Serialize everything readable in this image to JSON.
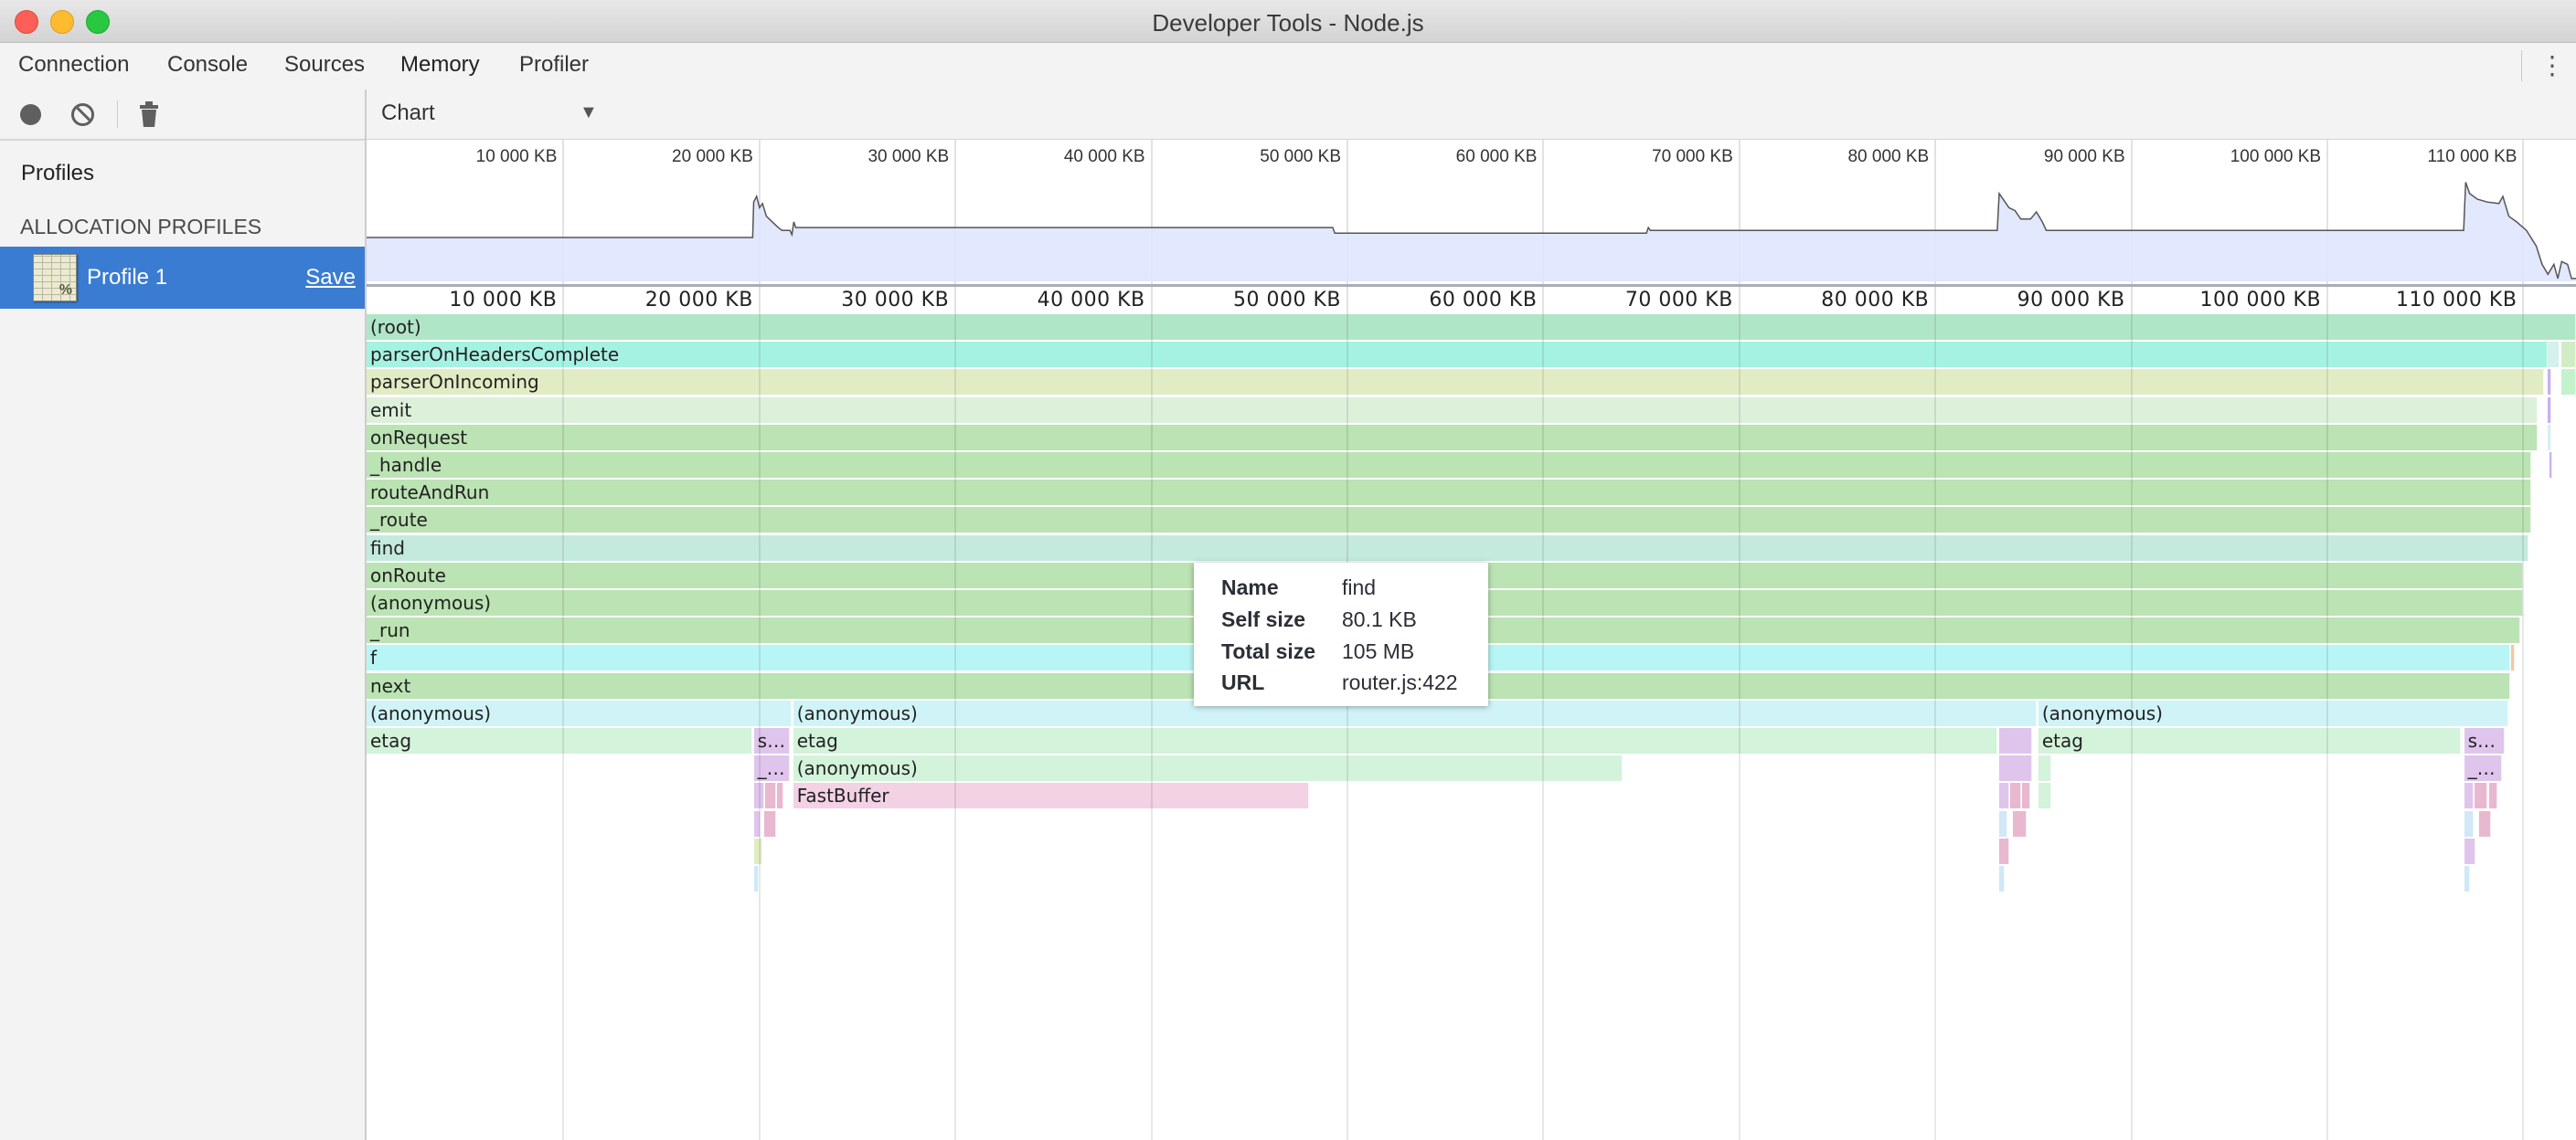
{
  "window": {
    "title": "Developer Tools - Node.js"
  },
  "tabs": [
    {
      "label": "Connection",
      "active": false
    },
    {
      "label": "Console",
      "active": false
    },
    {
      "label": "Sources",
      "active": false
    },
    {
      "label": "Memory",
      "active": true
    },
    {
      "label": "Profiler",
      "active": false
    }
  ],
  "toolbar": {
    "record_icon": "record-circle",
    "clear_icon": "no-entry",
    "delete_icon": "trash"
  },
  "sidebar": {
    "heading": "Profiles",
    "section": "ALLOCATION PROFILES",
    "profiles": [
      {
        "name": "Profile 1",
        "save_label": "Save",
        "selected": true,
        "icon_glyph": "%"
      }
    ]
  },
  "view": {
    "selected": "Chart"
  },
  "axis": {
    "unit": "KB",
    "max_kb": 112730,
    "ticks": [
      {
        "value": 10000,
        "label": "10 000 KB"
      },
      {
        "value": 20000,
        "label": "20 000 KB"
      },
      {
        "value": 30000,
        "label": "30 000 KB"
      },
      {
        "value": 40000,
        "label": "40 000 KB"
      },
      {
        "value": 50000,
        "label": "50 000 KB"
      },
      {
        "value": 60000,
        "label": "60 000 KB"
      },
      {
        "value": 70000,
        "label": "70 000 KB"
      },
      {
        "value": 80000,
        "label": "80 000 KB"
      },
      {
        "value": 90000,
        "label": "90 000 KB"
      },
      {
        "value": 100000,
        "label": "100 000 KB"
      },
      {
        "value": 110000,
        "label": "110 000 KB"
      }
    ]
  },
  "overview": {
    "fill": "#dfe5fd",
    "line": "#555555",
    "levels": [
      [
        0,
        0.31
      ],
      [
        19700,
        0.31
      ],
      [
        19750,
        0.56
      ],
      [
        19900,
        0.6
      ],
      [
        20050,
        0.52
      ],
      [
        20200,
        0.55
      ],
      [
        20400,
        0.46
      ],
      [
        20700,
        0.42
      ],
      [
        21000,
        0.38
      ],
      [
        21200,
        0.36
      ],
      [
        21600,
        0.36
      ],
      [
        21700,
        0.33
      ],
      [
        21800,
        0.42
      ],
      [
        21900,
        0.38
      ],
      [
        49300,
        0.38
      ],
      [
        49400,
        0.34
      ],
      [
        65300,
        0.34
      ],
      [
        65400,
        0.38
      ],
      [
        65500,
        0.36
      ],
      [
        83200,
        0.36
      ],
      [
        83300,
        0.62
      ],
      [
        83500,
        0.58
      ],
      [
        83800,
        0.52
      ],
      [
        84100,
        0.5
      ],
      [
        84400,
        0.44
      ],
      [
        84900,
        0.44
      ],
      [
        85200,
        0.49
      ],
      [
        85500,
        0.42
      ],
      [
        85700,
        0.36
      ],
      [
        107000,
        0.36
      ],
      [
        107100,
        0.7
      ],
      [
        107300,
        0.62
      ],
      [
        107700,
        0.58
      ],
      [
        108200,
        0.56
      ],
      [
        108800,
        0.55
      ],
      [
        109000,
        0.6
      ],
      [
        109300,
        0.46
      ],
      [
        109700,
        0.42
      ],
      [
        110200,
        0.36
      ],
      [
        110700,
        0.25
      ],
      [
        111000,
        0.12
      ],
      [
        111300,
        0.05
      ],
      [
        111600,
        0.12
      ],
      [
        111800,
        0.02
      ],
      [
        112000,
        0.14
      ],
      [
        112300,
        0.12
      ],
      [
        112500,
        0.02
      ],
      [
        112730,
        0.02
      ]
    ]
  },
  "flame": {
    "frames": [
      {
        "row": 0,
        "name": "(root)",
        "start": 0,
        "end": 112730,
        "color": "#b0e6c8"
      },
      {
        "row": 1,
        "name": "parserOnHeadersComplete",
        "start": 0,
        "end": 111290,
        "color": "#a6f2e2"
      },
      {
        "row": 1,
        "name": "",
        "start": 111300,
        "end": 111900,
        "color": "#d6f0ee"
      },
      {
        "row": 1,
        "name": "",
        "start": 112000,
        "end": 112730,
        "color": "#d2ecc8"
      },
      {
        "row": 2,
        "name": "parserOnIncoming",
        "start": 0,
        "end": 111120,
        "color": "#e2ecc4"
      },
      {
        "row": 2,
        "name": "",
        "start": 111300,
        "end": 111450,
        "color": "#c9b0ec"
      },
      {
        "row": 2,
        "name": "",
        "start": 112000,
        "end": 112730,
        "color": "#c3f3cc"
      },
      {
        "row": 3,
        "name": "emit",
        "start": 0,
        "end": 110790,
        "color": "#dcf0da"
      },
      {
        "row": 3,
        "name": "",
        "start": 111300,
        "end": 111450,
        "color": "#c9b0ec"
      },
      {
        "row": 4,
        "name": "onRequest",
        "start": 0,
        "end": 110790,
        "color": "#bbe3b3"
      },
      {
        "row": 4,
        "name": "",
        "start": 111300,
        "end": 111450,
        "color": "#d6f0ee"
      },
      {
        "row": 5,
        "name": "_handle",
        "start": 0,
        "end": 110450,
        "color": "#bbe3b3"
      },
      {
        "row": 5,
        "name": "",
        "start": 111400,
        "end": 111500,
        "color": "#c9b0ec"
      },
      {
        "row": 6,
        "name": "routeAndRun",
        "start": 0,
        "end": 110450,
        "color": "#bbe3b3"
      },
      {
        "row": 7,
        "name": "_route",
        "start": 0,
        "end": 110450,
        "color": "#bbe3b3"
      },
      {
        "row": 8,
        "name": "find",
        "start": 0,
        "end": 110290,
        "color": "#c4eade"
      },
      {
        "row": 9,
        "name": "onRoute",
        "start": 0,
        "end": 110040,
        "color": "#bbe3b3"
      },
      {
        "row": 10,
        "name": "(anonymous)",
        "start": 0,
        "end": 110040,
        "color": "#bbe3b3"
      },
      {
        "row": 11,
        "name": "_run",
        "start": 0,
        "end": 109870,
        "color": "#bbe3b3"
      },
      {
        "row": 12,
        "name": "f",
        "start": 0,
        "end": 109370,
        "color": "#b8f5f5"
      },
      {
        "row": 12,
        "name": "",
        "start": 109400,
        "end": 109600,
        "color": "#f3c8a0"
      },
      {
        "row": 13,
        "name": "next",
        "start": 0,
        "end": 109370,
        "color": "#bbe3b3"
      },
      {
        "row": 14,
        "name": "(anonymous)",
        "start": 0,
        "end": 21690,
        "color": "#d0f3f7"
      },
      {
        "row": 14,
        "name": "(anonymous)",
        "start": 21770,
        "end": 85220,
        "color": "#d0f3f7"
      },
      {
        "row": 14,
        "name": "(anonymous)",
        "start": 85300,
        "end": 109280,
        "color": "#d0f3f7"
      },
      {
        "row": 15,
        "name": "etag",
        "start": 0,
        "end": 19670,
        "color": "#d3f3da"
      },
      {
        "row": 15,
        "name": "s…",
        "start": 19760,
        "end": 21600,
        "color": "#dfc5ec"
      },
      {
        "row": 15,
        "name": "etag",
        "start": 21770,
        "end": 83210,
        "color": "#d3f3da"
      },
      {
        "row": 15,
        "name": "",
        "start": 83290,
        "end": 84970,
        "color": "#dfc5ec"
      },
      {
        "row": 15,
        "name": "etag",
        "start": 85300,
        "end": 106850,
        "color": "#d3f3da"
      },
      {
        "row": 15,
        "name": "s…",
        "start": 107020,
        "end": 109110,
        "color": "#dfc5ec"
      },
      {
        "row": 16,
        "name": "_…",
        "start": 19760,
        "end": 21600,
        "color": "#dfc5ec"
      },
      {
        "row": 16,
        "name": "(anonymous)",
        "start": 21770,
        "end": 64100,
        "color": "#d3f3da"
      },
      {
        "row": 16,
        "name": "",
        "start": 83290,
        "end": 84970,
        "color": "#dfc5ec"
      },
      {
        "row": 16,
        "name": "",
        "start": 85300,
        "end": 85950,
        "color": "#d3f3da"
      },
      {
        "row": 16,
        "name": "_…",
        "start": 107020,
        "end": 108940,
        "color": "#dfc5ec"
      },
      {
        "row": 17,
        "name": "",
        "start": 19760,
        "end": 20300,
        "color": "#dfc5ec"
      },
      {
        "row": 17,
        "name": "",
        "start": 20350,
        "end": 20900,
        "color": "#e8b8d0"
      },
      {
        "row": 17,
        "name": "",
        "start": 20950,
        "end": 21250,
        "color": "#e8b8d0"
      },
      {
        "row": 17,
        "name": "FastBuffer",
        "start": 21770,
        "end": 48090,
        "color": "#f2d2e4"
      },
      {
        "row": 17,
        "name": "",
        "start": 83290,
        "end": 83800,
        "color": "#dfc5ec"
      },
      {
        "row": 17,
        "name": "",
        "start": 83850,
        "end": 84400,
        "color": "#e8b8d0"
      },
      {
        "row": 17,
        "name": "",
        "start": 84450,
        "end": 84900,
        "color": "#e8b8d0"
      },
      {
        "row": 17,
        "name": "",
        "start": 85300,
        "end": 85950,
        "color": "#d3f3da"
      },
      {
        "row": 17,
        "name": "",
        "start": 107020,
        "end": 107500,
        "color": "#dfc5ec"
      },
      {
        "row": 17,
        "name": "",
        "start": 107550,
        "end": 108200,
        "color": "#e8b8d0"
      },
      {
        "row": 17,
        "name": "",
        "start": 108300,
        "end": 108700,
        "color": "#e8b8d0"
      },
      {
        "row": 18,
        "name": "",
        "start": 19760,
        "end": 20100,
        "color": "#dfc5ec"
      },
      {
        "row": 18,
        "name": "",
        "start": 20300,
        "end": 20900,
        "color": "#e8b8d0"
      },
      {
        "row": 18,
        "name": "",
        "start": 83290,
        "end": 83700,
        "color": "#d0e8f7"
      },
      {
        "row": 18,
        "name": "",
        "start": 84000,
        "end": 84700,
        "color": "#e8b8d0"
      },
      {
        "row": 18,
        "name": "",
        "start": 107020,
        "end": 107500,
        "color": "#d0e8f7"
      },
      {
        "row": 18,
        "name": "",
        "start": 107800,
        "end": 108400,
        "color": "#e8b8d0"
      },
      {
        "row": 19,
        "name": "",
        "start": 19760,
        "end": 20200,
        "color": "#e2ecc4"
      },
      {
        "row": 19,
        "name": "",
        "start": 83290,
        "end": 83800,
        "color": "#e8b8d0"
      },
      {
        "row": 19,
        "name": "",
        "start": 107020,
        "end": 107600,
        "color": "#dfc5ec"
      },
      {
        "row": 20,
        "name": "",
        "start": 19760,
        "end": 20000,
        "color": "#d0e8f7"
      },
      {
        "row": 20,
        "name": "",
        "start": 83290,
        "end": 83600,
        "color": "#d0e8f7"
      },
      {
        "row": 20,
        "name": "",
        "start": 107020,
        "end": 107300,
        "color": "#d0e8f7"
      }
    ]
  },
  "tooltip": {
    "rows": [
      {
        "key": "Name",
        "value": "find"
      },
      {
        "key": "Self size",
        "value": "80.1 KB"
      },
      {
        "key": "Total size",
        "value": "105 MB"
      },
      {
        "key": "URL",
        "value": "router.js:422"
      }
    ]
  }
}
